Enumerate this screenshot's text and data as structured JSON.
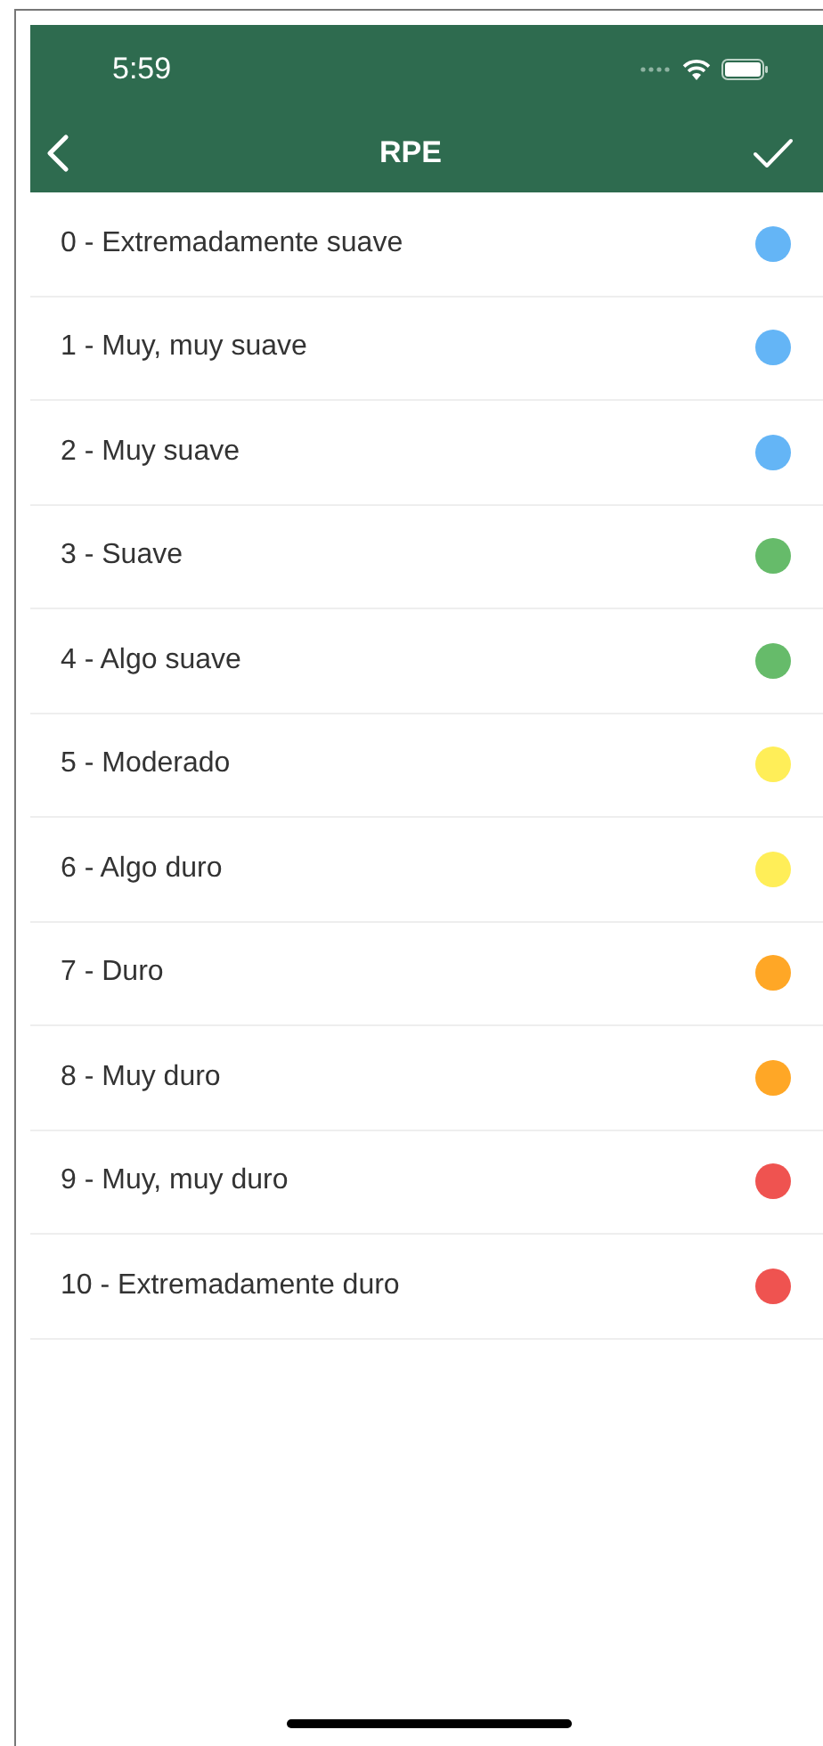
{
  "status_bar": {
    "time": "5:59"
  },
  "nav": {
    "title": "RPE"
  },
  "items": [
    {
      "label": "0 - Extremadamente suave",
      "color": "#64b5f6"
    },
    {
      "label": "1 - Muy, muy suave",
      "color": "#64b5f6"
    },
    {
      "label": "2 - Muy suave",
      "color": "#64b5f6"
    },
    {
      "label": "3 - Suave",
      "color": "#66bb6a"
    },
    {
      "label": "4 - Algo suave",
      "color": "#66bb6a"
    },
    {
      "label": "5 - Moderado",
      "color": "#ffee58"
    },
    {
      "label": "6 - Algo duro",
      "color": "#ffee58"
    },
    {
      "label": "7 - Duro",
      "color": "#ffa726"
    },
    {
      "label": "8 - Muy duro",
      "color": "#ffa726"
    },
    {
      "label": "9 - Muy, muy duro",
      "color": "#ef5350"
    },
    {
      "label": "10 - Extremadamente duro",
      "color": "#ef5350"
    }
  ]
}
